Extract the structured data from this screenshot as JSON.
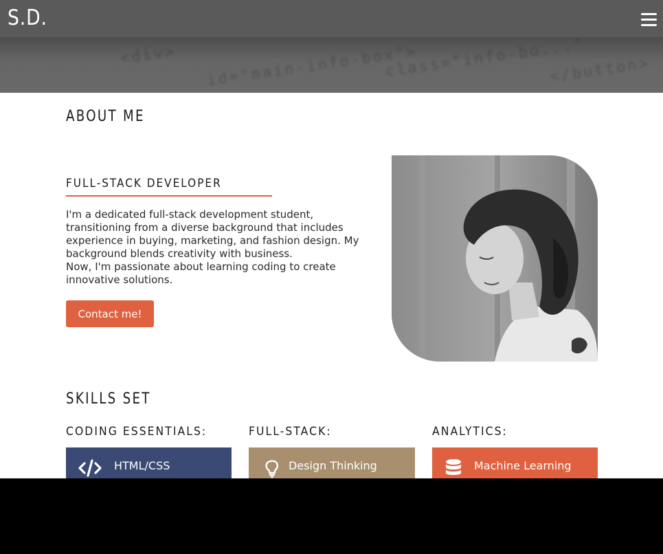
{
  "header": {
    "logo": "S.D.",
    "menu_icon": "hamburger-menu-icon",
    "hero_code": [
      "<div>",
      "id=\"main-info-box\">",
      "class=\"info-bo...\"",
      "</button>"
    ]
  },
  "about": {
    "title": "ABOUT ME",
    "subtitle": "FULL-STACK DEVELOPER",
    "bio_lines": [
      "I'm a dedicated full-stack development student,",
      "transitioning from a diverse background that includes",
      "experience in buying, marketing, and fashion design. My",
      "background blends creativity with business.",
      "Now, I'm passionate about learning coding to create",
      "innovative solutions."
    ],
    "contact_label": "Contact me!"
  },
  "skills": {
    "title": "SKILLS SET",
    "columns": [
      {
        "heading": "CODING ESSENTIALS:",
        "item": "HTML/CSS",
        "icon": "code-icon",
        "color": "#3a4a74"
      },
      {
        "heading": "FULL-STACK:",
        "item": "Design Thinking",
        "icon": "lightbulb-icon",
        "color": "#a8906f"
      },
      {
        "heading": "ANALYTICS:",
        "item": "Machine Learning",
        "icon": "database-icon",
        "color": "#e0613f"
      }
    ]
  },
  "colors": {
    "accent": "#e0613f",
    "header_bg": "#5a5a5a"
  }
}
